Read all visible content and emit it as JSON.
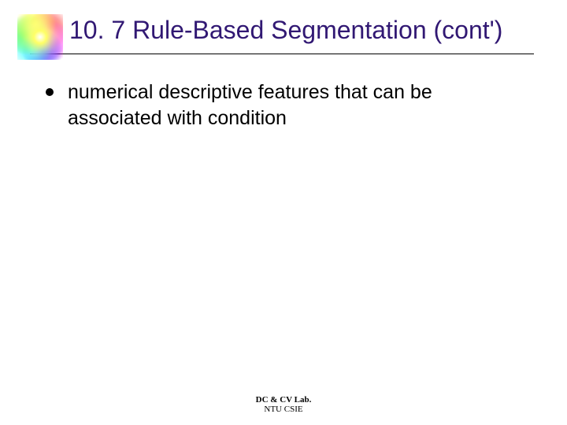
{
  "title": "10. 7 Rule-Based Segmentation (cont')",
  "bullet": "numerical descriptive features that can be associated with condition",
  "footer": {
    "line1": "DC & CV Lab.",
    "line2": "NTU CSIE"
  }
}
